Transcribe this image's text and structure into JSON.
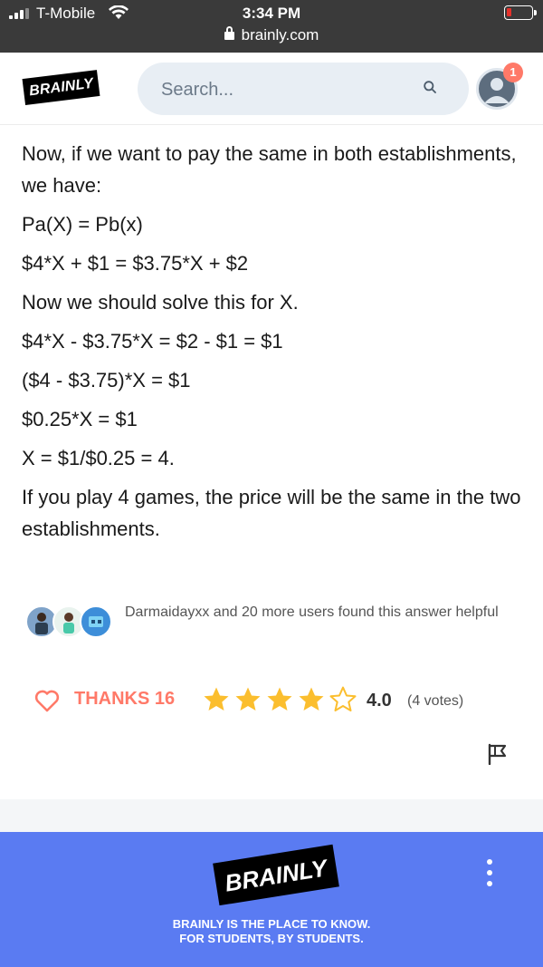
{
  "status_bar": {
    "carrier": "T-Mobile",
    "time": "3:34 PM",
    "url": "brainly.com"
  },
  "header": {
    "logo": "BRAINLY",
    "search_placeholder": "Search...",
    "notification_count": "1"
  },
  "answer": {
    "paragraphs": [
      "Now, if we want to pay the same in both establishments, we have:",
      "Pa(X) = Pb(x)",
      "$4*X + $1 = $3.75*X + $2",
      "Now we should solve this for X.",
      "$4*X - $3.75*X = $2 - $1 = $1",
      "($4 - $3.75)*X = $1",
      "$0.25*X = $1",
      "X = $1/$0.25 = 4.",
      "If you play 4 games, the price will be the same in the two establishments."
    ]
  },
  "helpful": {
    "text": "Darmaidayxx and 20 more users found this answer helpful"
  },
  "actions": {
    "thanks_label": "THANKS 16",
    "rating": "4.0",
    "votes": "(4 votes)",
    "stars_filled": 4,
    "stars_total": 5
  },
  "footer": {
    "logo": "BRAINLY",
    "tagline_line1": "BRAINLY IS THE PLACE TO KNOW.",
    "tagline_line2": "FOR STUDENTS, BY STUDENTS."
  },
  "colors": {
    "accent_coral": "#ff7968",
    "star_gold": "#fbbe2e",
    "footer_blue": "#5a7bf2",
    "status_bar": "#3a3a3a"
  }
}
